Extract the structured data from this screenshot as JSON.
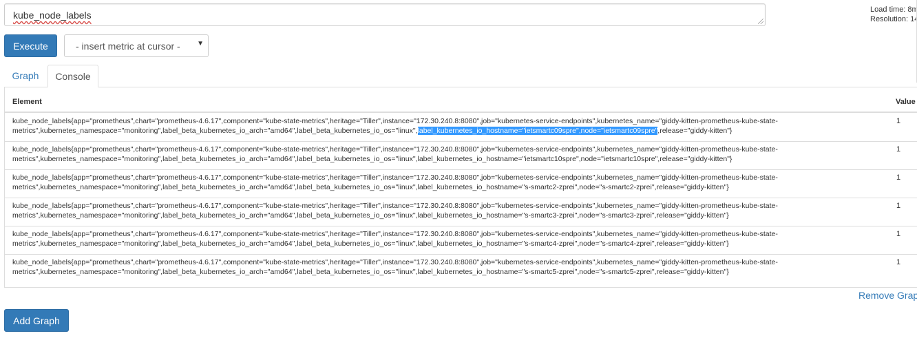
{
  "expression": {
    "value": "kube_node_labels"
  },
  "stats": {
    "load_time": "Load time: 8m",
    "resolution": "Resolution: 14"
  },
  "toolbar": {
    "execute_label": "Execute",
    "metric_select": "- insert metric at cursor -"
  },
  "tabs": [
    {
      "label": "Graph"
    },
    {
      "label": "Console"
    }
  ],
  "table": {
    "headers": {
      "element": "Element",
      "value": "Value"
    },
    "rows": [
      {
        "line1": "kube_node_labels{app=\"prometheus\",chart=\"prometheus-4.6.17\",component=\"kube-state-metrics\",heritage=\"Tiller\",instance=\"172.30.240.8:8080\",job=\"kubernetes-service-endpoints\",kubernetes_name=\"giddy-kitten-prometheus-kube-state-",
        "line2_pre": "metrics\",kubernetes_namespace=\"monitoring\",label_beta_kubernetes_io_arch=\"amd64\",label_beta_kubernetes_io_os=\"linux\",",
        "line2_hl": "label_kubernetes_io_hostname=\"ietsmartc09spre\",node=\"ietsmartc09spre\"",
        "line2_post": ",release=\"giddy-kitten\"}",
        "value": "1"
      },
      {
        "line1": "kube_node_labels{app=\"prometheus\",chart=\"prometheus-4.6.17\",component=\"kube-state-metrics\",heritage=\"Tiller\",instance=\"172.30.240.8:8080\",job=\"kubernetes-service-endpoints\",kubernetes_name=\"giddy-kitten-prometheus-kube-state-",
        "line2": "metrics\",kubernetes_namespace=\"monitoring\",label_beta_kubernetes_io_arch=\"amd64\",label_beta_kubernetes_io_os=\"linux\",label_kubernetes_io_hostname=\"ietsmartc10spre\",node=\"ietsmartc10spre\",release=\"giddy-kitten\"}",
        "value": "1"
      },
      {
        "line1": "kube_node_labels{app=\"prometheus\",chart=\"prometheus-4.6.17\",component=\"kube-state-metrics\",heritage=\"Tiller\",instance=\"172.30.240.8:8080\",job=\"kubernetes-service-endpoints\",kubernetes_name=\"giddy-kitten-prometheus-kube-state-",
        "line2": "metrics\",kubernetes_namespace=\"monitoring\",label_beta_kubernetes_io_arch=\"amd64\",label_beta_kubernetes_io_os=\"linux\",label_kubernetes_io_hostname=\"s-smartc2-zprei\",node=\"s-smartc2-zprei\",release=\"giddy-kitten\"}",
        "value": "1"
      },
      {
        "line1": "kube_node_labels{app=\"prometheus\",chart=\"prometheus-4.6.17\",component=\"kube-state-metrics\",heritage=\"Tiller\",instance=\"172.30.240.8:8080\",job=\"kubernetes-service-endpoints\",kubernetes_name=\"giddy-kitten-prometheus-kube-state-",
        "line2": "metrics\",kubernetes_namespace=\"monitoring\",label_beta_kubernetes_io_arch=\"amd64\",label_beta_kubernetes_io_os=\"linux\",label_kubernetes_io_hostname=\"s-smartc3-zprei\",node=\"s-smartc3-zprei\",release=\"giddy-kitten\"}",
        "value": "1"
      },
      {
        "line1": "kube_node_labels{app=\"prometheus\",chart=\"prometheus-4.6.17\",component=\"kube-state-metrics\",heritage=\"Tiller\",instance=\"172.30.240.8:8080\",job=\"kubernetes-service-endpoints\",kubernetes_name=\"giddy-kitten-prometheus-kube-state-",
        "line2": "metrics\",kubernetes_namespace=\"monitoring\",label_beta_kubernetes_io_arch=\"amd64\",label_beta_kubernetes_io_os=\"linux\",label_kubernetes_io_hostname=\"s-smartc4-zprei\",node=\"s-smartc4-zprei\",release=\"giddy-kitten\"}",
        "value": "1"
      },
      {
        "line1": "kube_node_labels{app=\"prometheus\",chart=\"prometheus-4.6.17\",component=\"kube-state-metrics\",heritage=\"Tiller\",instance=\"172.30.240.8:8080\",job=\"kubernetes-service-endpoints\",kubernetes_name=\"giddy-kitten-prometheus-kube-state-",
        "line2": "metrics\",kubernetes_namespace=\"monitoring\",label_beta_kubernetes_io_arch=\"amd64\",label_beta_kubernetes_io_os=\"linux\",label_kubernetes_io_hostname=\"s-smartc5-zprei\",node=\"s-smartc5-zprei\",release=\"giddy-kitten\"}",
        "value": "1"
      }
    ]
  },
  "actions": {
    "remove_graph": "Remove Grap",
    "add_graph": "Add Graph"
  },
  "colors": {
    "primary": "#337ab7",
    "highlight": "#3399ff",
    "border": "#dddddd"
  },
  "icons": {
    "select_caret": "caret-down-icon",
    "resize": "resize-grip-icon"
  }
}
